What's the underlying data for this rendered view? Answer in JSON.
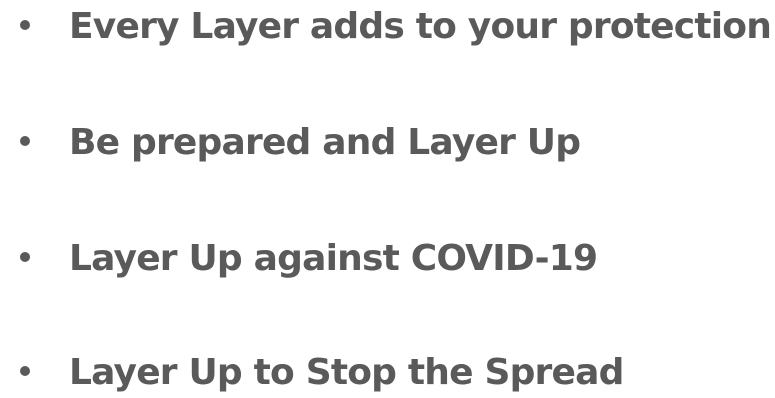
{
  "bullets": [
    {
      "text": "Every Layer adds to your protection"
    },
    {
      "text": "Be prepared and Layer Up"
    },
    {
      "text": "Layer Up against COVID-19"
    },
    {
      "text": "Layer Up to Stop the Spread"
    }
  ],
  "colors": {
    "text": "#5a5a5a",
    "background": "#ffffff"
  }
}
